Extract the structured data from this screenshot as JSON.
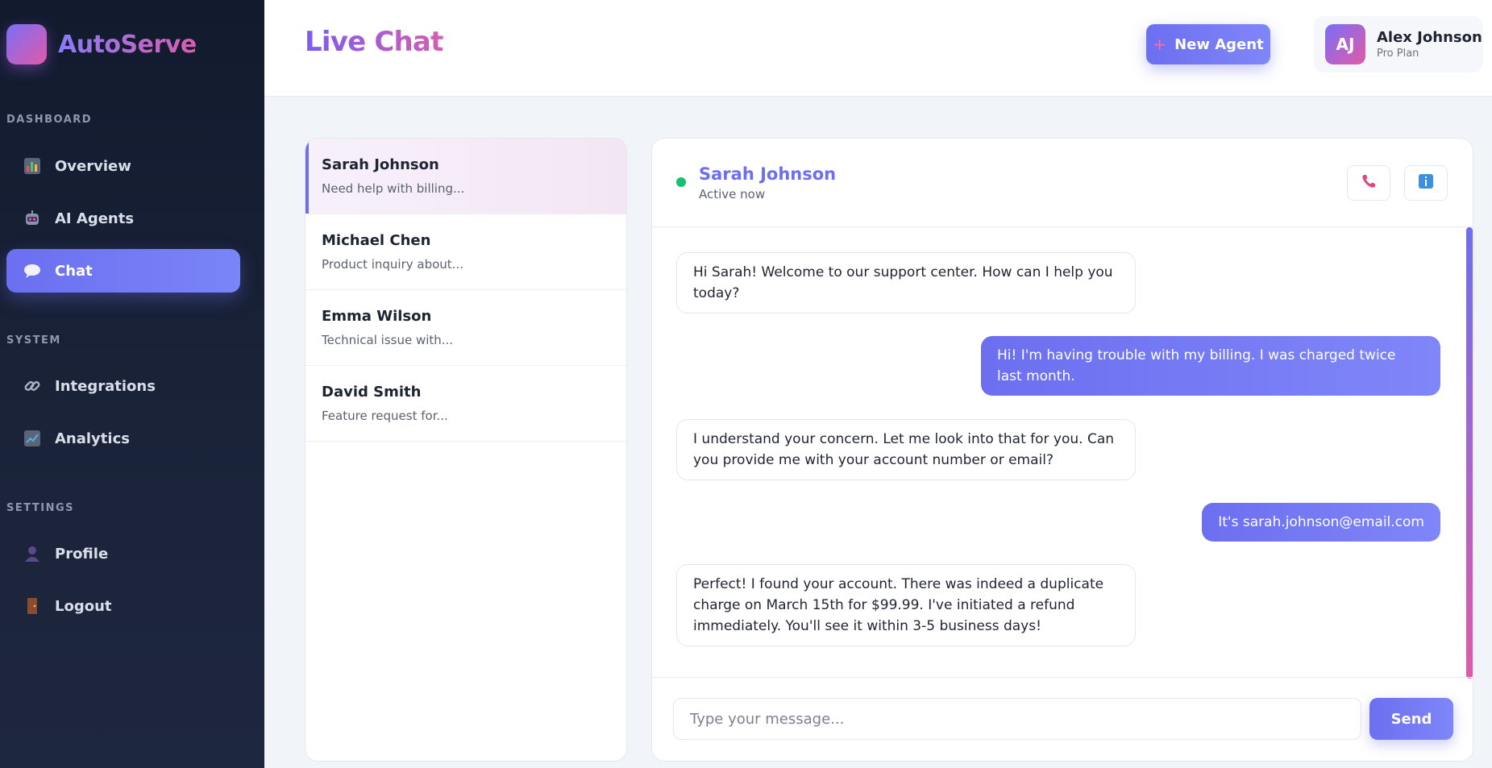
{
  "sidebar": {
    "brand": "AutoServe",
    "sections": [
      {
        "label": "DASHBOARD",
        "items": [
          {
            "label": "Overview",
            "icon": "bar-chart-icon",
            "active": false
          },
          {
            "label": "AI Agents",
            "icon": "robot-icon",
            "active": false
          },
          {
            "label": "Chat",
            "icon": "speech-bubble-icon",
            "active": true
          }
        ]
      },
      {
        "label": "SYSTEM",
        "items": [
          {
            "label": "Integrations",
            "icon": "link-icon",
            "active": false
          },
          {
            "label": "Analytics",
            "icon": "line-chart-icon",
            "active": false
          }
        ]
      },
      {
        "label": "SETTINGS",
        "items": [
          {
            "label": "Profile",
            "icon": "user-icon",
            "active": false
          },
          {
            "label": "Logout",
            "icon": "door-icon",
            "active": false
          }
        ]
      }
    ]
  },
  "header": {
    "title": "Live Chat",
    "new_agent_label": "New Agent",
    "user": {
      "initials": "AJ",
      "name": "Alex Johnson",
      "plan": "Pro Plan"
    }
  },
  "conversations": [
    {
      "name": "Sarah Johnson",
      "preview": "Need help with billing...",
      "active": true
    },
    {
      "name": "Michael Chen",
      "preview": "Product inquiry about...",
      "active": false
    },
    {
      "name": "Emma Wilson",
      "preview": "Technical issue with...",
      "active": false
    },
    {
      "name": "David Smith",
      "preview": "Feature request for...",
      "active": false
    }
  ],
  "chat": {
    "contact_name": "Sarah Johnson",
    "status": "Active now",
    "messages": [
      {
        "from": "agent",
        "text": "Hi Sarah! Welcome to our support center. How can I help you today?"
      },
      {
        "from": "user",
        "text": "Hi! I'm having trouble with my billing. I was charged twice last month."
      },
      {
        "from": "agent",
        "text": "I understand your concern. Let me look into that for you. Can you provide me with your account number or email?"
      },
      {
        "from": "user",
        "text": "It's sarah.johnson@email.com"
      },
      {
        "from": "agent",
        "text": "Perfect! I found your account. There was indeed a duplicate charge on March 15th for $99.99. I've initiated a refund immediately. You'll see it within 3-5 business days!"
      }
    ],
    "input_placeholder": "Type your message...",
    "send_label": "Send"
  },
  "colors": {
    "accent": "#6c6ff0",
    "accent_pink": "#e05aa8",
    "online": "#16c172",
    "sidebar_bg": "#121a2e"
  }
}
